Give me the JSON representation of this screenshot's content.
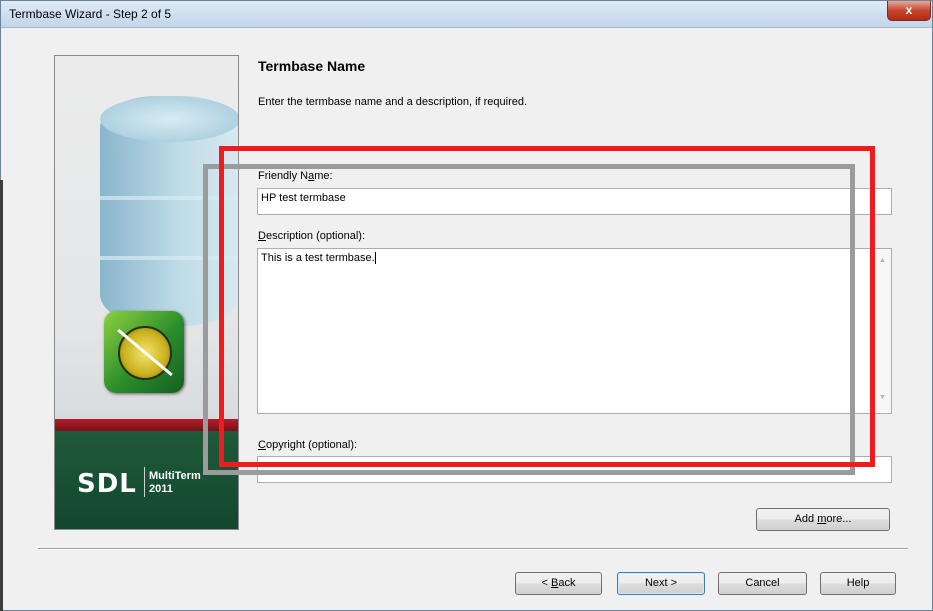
{
  "window": {
    "title": "Termbase Wizard - Step 2 of 5",
    "close_glyph": "x"
  },
  "side_panel": {
    "logo_sdl": "SDL",
    "logo_product_line1": "MultiTerm",
    "logo_product_line2": "2011"
  },
  "page": {
    "heading": "Termbase Name",
    "instructions": "Enter the termbase name and a description, if required."
  },
  "form": {
    "friendly_name": {
      "label_pre": "Friendly N",
      "label_key": "a",
      "label_post": "me:",
      "value": "HP test termbase"
    },
    "description": {
      "label_key": "D",
      "label_post": "escription (optional):",
      "value": "This is a test termbase."
    },
    "copyright": {
      "label_key": "C",
      "label_post": "opyright (optional):",
      "value": ""
    }
  },
  "buttons": {
    "add_more": {
      "pre": "Add ",
      "key": "m",
      "post": "ore..."
    },
    "back": {
      "pre": "< ",
      "key": "B",
      "post": "ack"
    },
    "next": "Next >",
    "cancel": "Cancel",
    "help": "Help"
  },
  "colors": {
    "annotation_red": "#ee1c1c",
    "annotation_gray": "#9b9b9b",
    "brand_green": "#1f5a3a",
    "brand_red": "#b31d2a"
  }
}
